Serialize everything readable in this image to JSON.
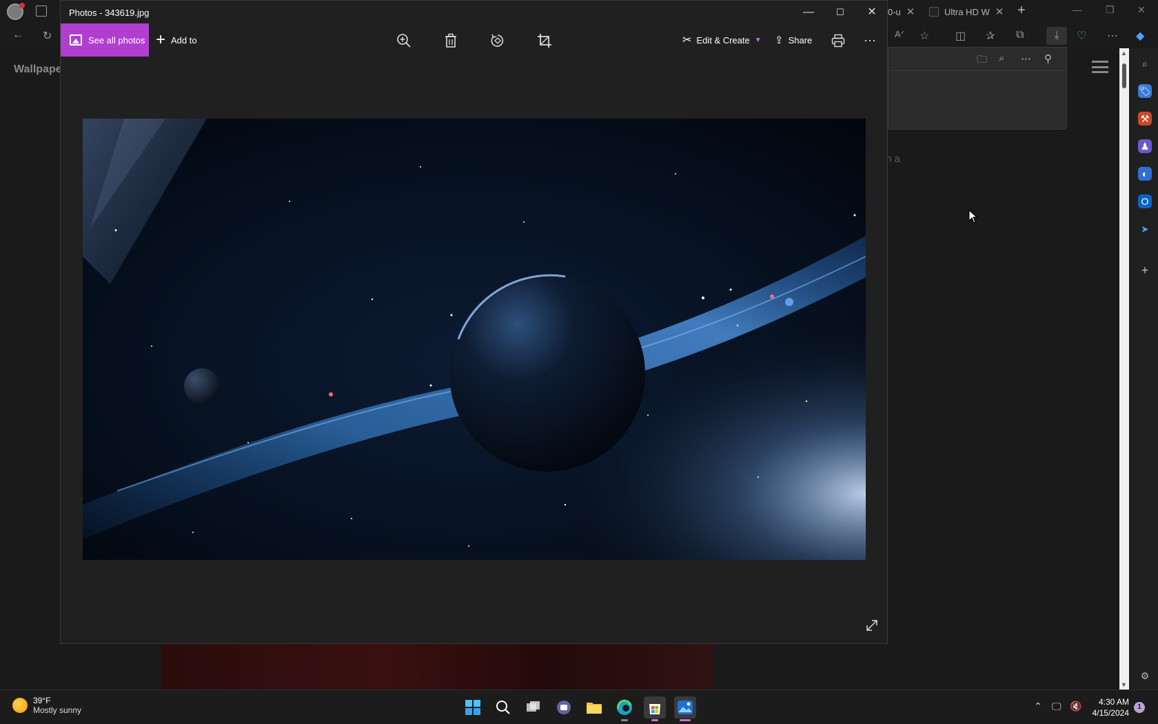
{
  "browser": {
    "tabs": [
      {
        "label": "0-u"
      },
      {
        "label": "Ultra HD W"
      }
    ],
    "new_tab": "+",
    "page": {
      "title_fragment": "Wallpape",
      "text_fragment": "n a"
    }
  },
  "photos": {
    "window_title": "Photos - 343619.jpg",
    "toolbar": {
      "see_all_label": "See all photos",
      "add_to_label": "Add to",
      "edit_create_label": "Edit & Create",
      "share_label": "Share"
    },
    "accent_color": "#b03fcf"
  },
  "taskbar": {
    "weather": {
      "temperature": "39°F",
      "condition": "Mostly sunny"
    },
    "clock": {
      "time": "4:30 AM",
      "date": "4/15/2024"
    },
    "notification_count": "1"
  }
}
